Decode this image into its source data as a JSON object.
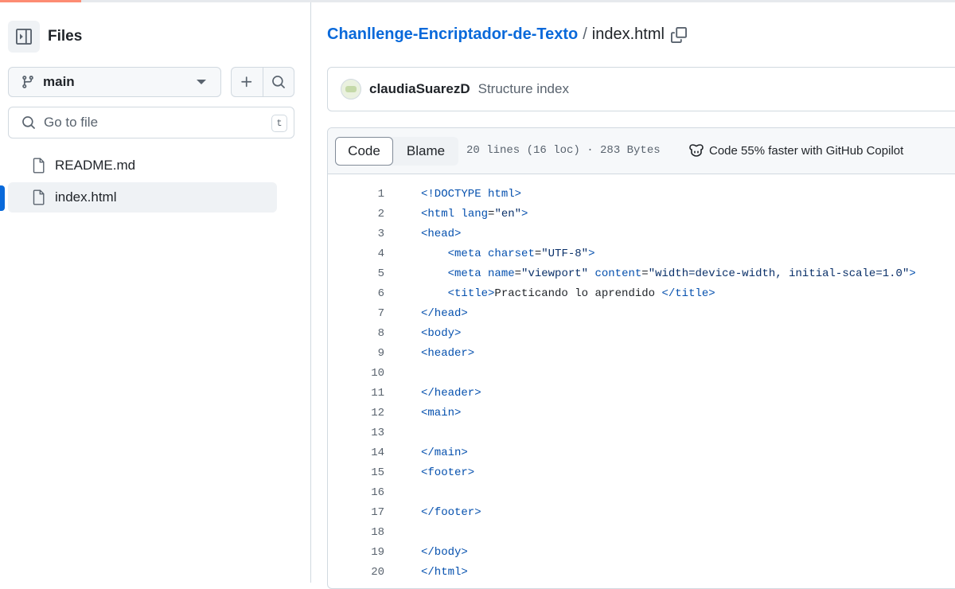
{
  "sidebar": {
    "title": "Files",
    "branch": "main",
    "search": {
      "placeholder": "Go to file",
      "shortcut": "t"
    },
    "files": [
      {
        "name": "README.md",
        "active": false
      },
      {
        "name": "index.html",
        "active": true
      }
    ]
  },
  "breadcrumb": {
    "repo": "Chanllenge-Encriptador-de-Texto",
    "separator": "/",
    "file": "index.html"
  },
  "commit": {
    "author": "claudiaSuarezD",
    "message": "Structure index"
  },
  "file_header": {
    "tabs": [
      "Code",
      "Blame"
    ],
    "active_tab": "Code",
    "meta": "20 lines (16 loc) · 283 Bytes",
    "copilot": "Code 55% faster with GitHub Copilot"
  },
  "code": {
    "lines": [
      {
        "n": "1",
        "tokens": [
          [
            "tag",
            "<!DOCTYPE html>"
          ]
        ]
      },
      {
        "n": "2",
        "tokens": [
          [
            "tag",
            "<html "
          ],
          [
            "attr",
            "lang"
          ],
          [
            "txt",
            "="
          ],
          [
            "str",
            "\"en\""
          ],
          [
            "tag",
            ">"
          ]
        ]
      },
      {
        "n": "3",
        "tokens": [
          [
            "tag",
            "<head>"
          ]
        ]
      },
      {
        "n": "4",
        "tokens": [
          [
            "txt",
            "    "
          ],
          [
            "tag",
            "<meta "
          ],
          [
            "attr",
            "charset"
          ],
          [
            "txt",
            "="
          ],
          [
            "str",
            "\"UTF-8\""
          ],
          [
            "tag",
            ">"
          ]
        ]
      },
      {
        "n": "5",
        "tokens": [
          [
            "txt",
            "    "
          ],
          [
            "tag",
            "<meta "
          ],
          [
            "attr",
            "name"
          ],
          [
            "txt",
            "="
          ],
          [
            "str",
            "\"viewport\""
          ],
          [
            "txt",
            " "
          ],
          [
            "attr",
            "content"
          ],
          [
            "txt",
            "="
          ],
          [
            "str",
            "\"width=device-width, initial-scale=1.0\""
          ],
          [
            "tag",
            ">"
          ]
        ]
      },
      {
        "n": "6",
        "tokens": [
          [
            "txt",
            "    "
          ],
          [
            "tag",
            "<title>"
          ],
          [
            "txt",
            "Practicando lo aprendido "
          ],
          [
            "tag",
            "</title>"
          ]
        ]
      },
      {
        "n": "7",
        "tokens": [
          [
            "tag",
            "</head>"
          ]
        ]
      },
      {
        "n": "8",
        "tokens": [
          [
            "tag",
            "<body>"
          ]
        ]
      },
      {
        "n": "9",
        "tokens": [
          [
            "tag",
            "<header>"
          ]
        ]
      },
      {
        "n": "10",
        "tokens": []
      },
      {
        "n": "11",
        "tokens": [
          [
            "tag",
            "</header>"
          ]
        ]
      },
      {
        "n": "12",
        "tokens": [
          [
            "tag",
            "<main>"
          ]
        ]
      },
      {
        "n": "13",
        "tokens": []
      },
      {
        "n": "14",
        "tokens": [
          [
            "tag",
            "</main>"
          ]
        ]
      },
      {
        "n": "15",
        "tokens": [
          [
            "tag",
            "<footer>"
          ]
        ]
      },
      {
        "n": "16",
        "tokens": []
      },
      {
        "n": "17",
        "tokens": [
          [
            "tag",
            "</footer>"
          ]
        ]
      },
      {
        "n": "18",
        "tokens": []
      },
      {
        "n": "19",
        "tokens": [
          [
            "tag",
            "</body>"
          ]
        ]
      },
      {
        "n": "20",
        "tokens": [
          [
            "tag",
            "</html>"
          ]
        ]
      }
    ]
  },
  "colors": {
    "link": "#0969da",
    "active_indicator": "#0969da",
    "tab_accent": "#fd8c73",
    "code_tag": "#0550ae",
    "code_string": "#0a3069"
  },
  "icons": [
    "sidebar-collapse-icon",
    "git-branch-icon",
    "plus-icon",
    "search-icon",
    "file-icon",
    "copy-icon",
    "copilot-icon",
    "caret-down-icon"
  ]
}
